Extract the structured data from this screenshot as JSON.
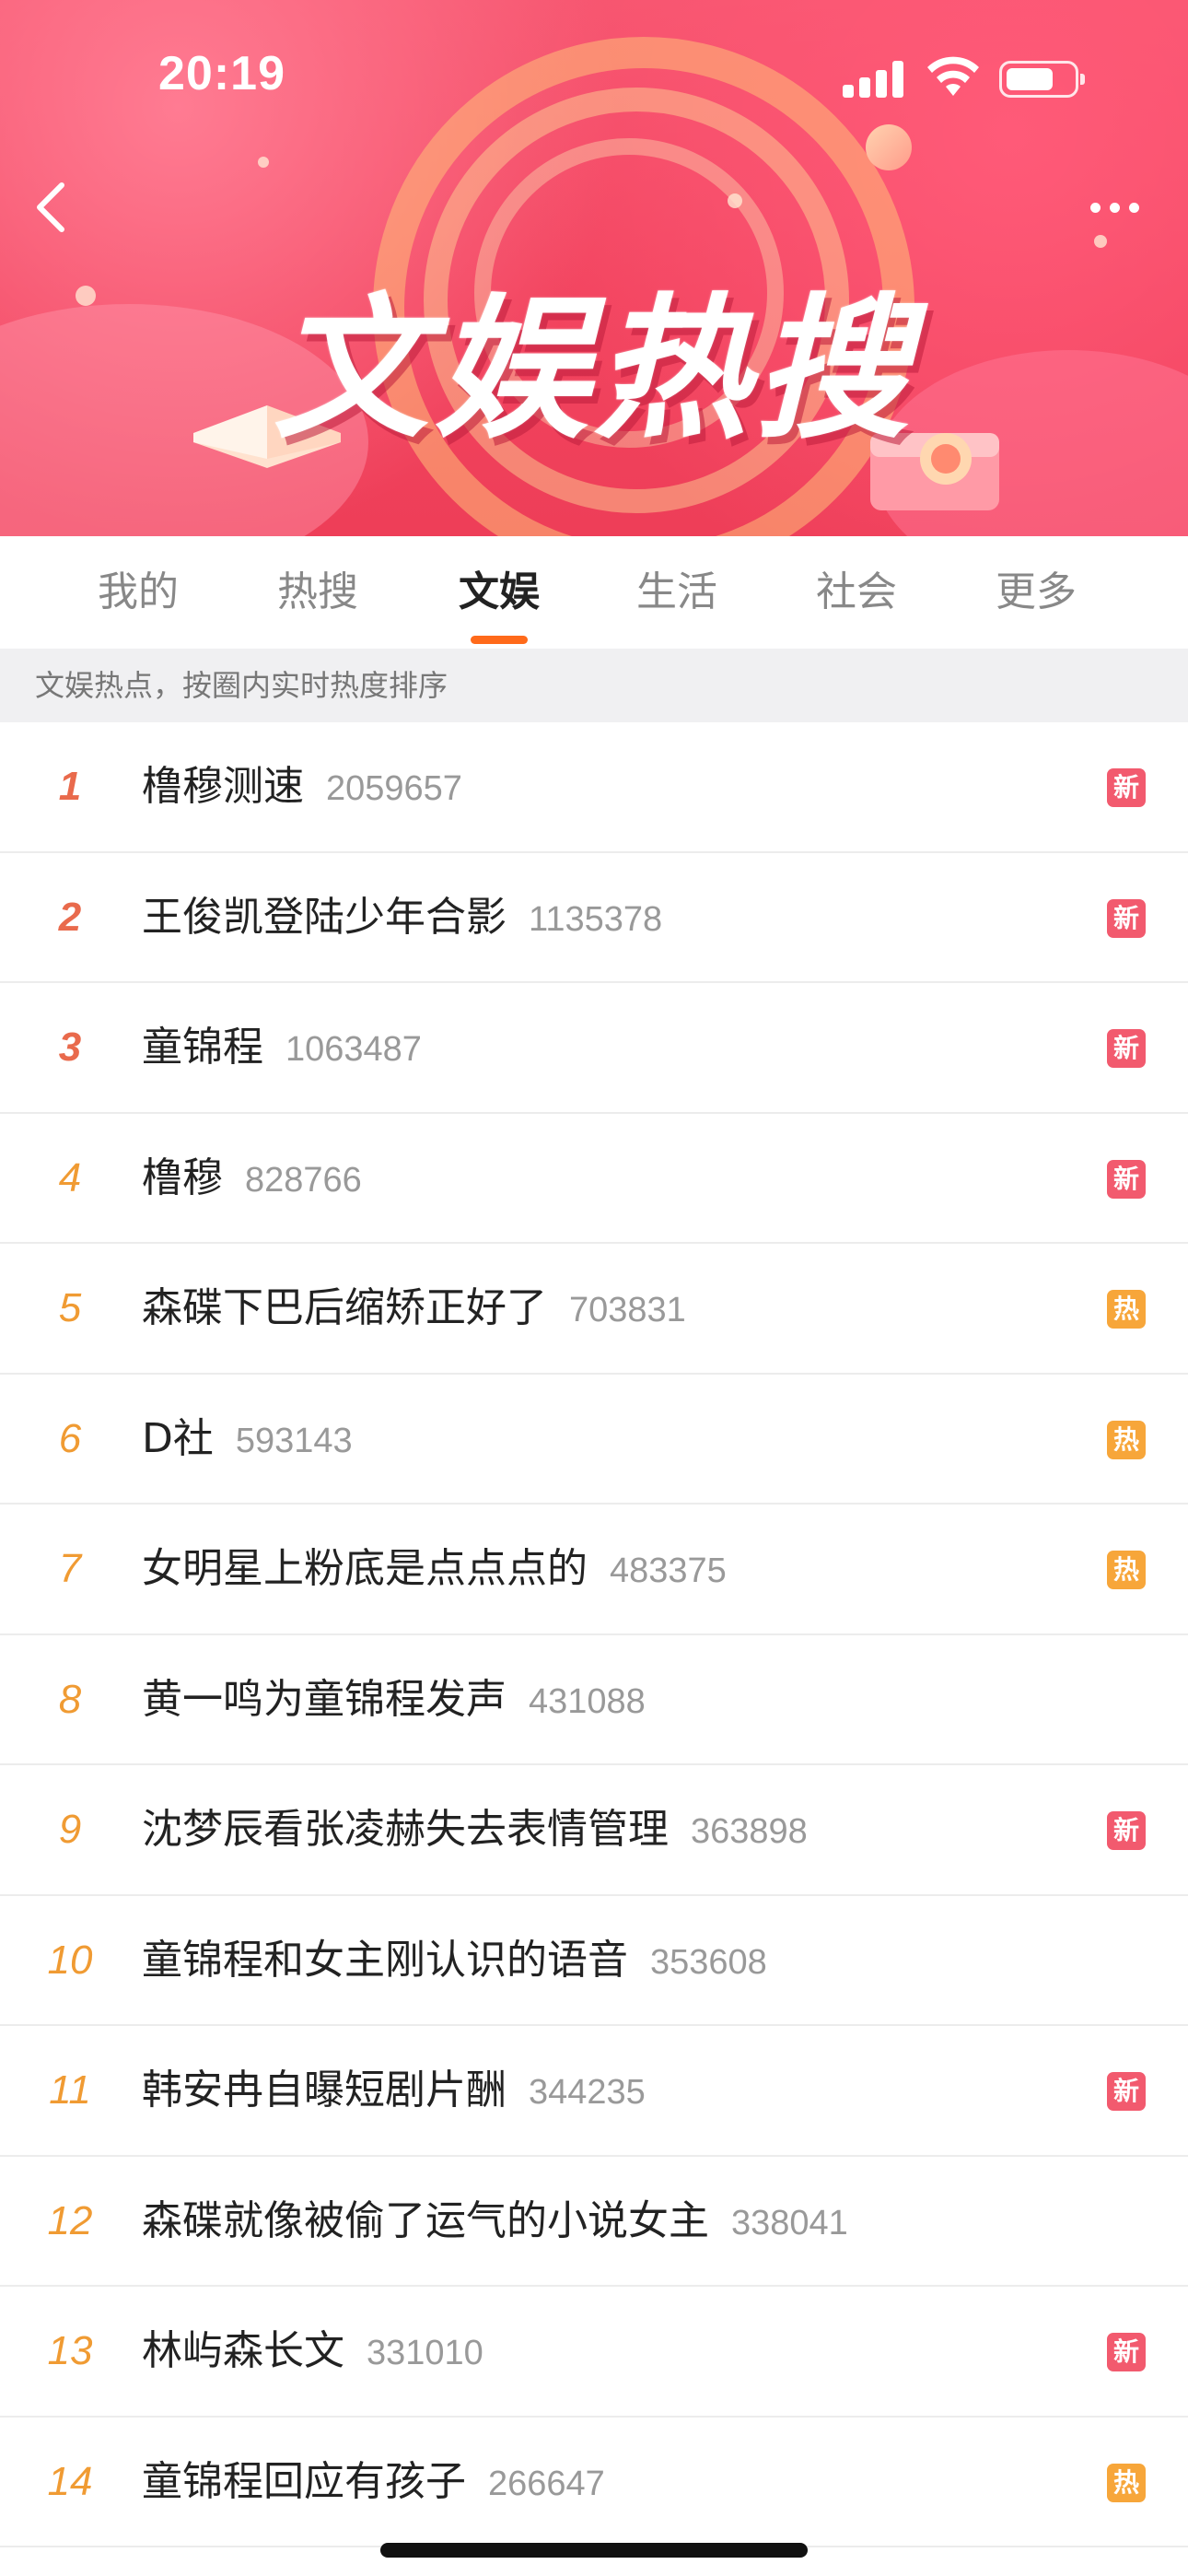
{
  "status_bar": {
    "time": "20:19"
  },
  "banner": {
    "title": "文娱热搜"
  },
  "tabs": [
    {
      "label": "我的"
    },
    {
      "label": "热搜"
    },
    {
      "label": "文娱"
    },
    {
      "label": "生活"
    },
    {
      "label": "社会"
    },
    {
      "label": "更多"
    }
  ],
  "active_tab": "文娱",
  "subtitle": "文娱热点，按圈内实时热度排序",
  "colors": {
    "accent": "#ff6a1a",
    "new_badge": "#f25a6e",
    "hot_badge": "#f7a63a",
    "rank_top": "#e96a4c",
    "rank_normal": "#f09b33"
  },
  "items": [
    {
      "rank": "1",
      "title": "橹穆测速",
      "heat": "2059657",
      "badge": "新"
    },
    {
      "rank": "2",
      "title": "王俊凯登陆少年合影",
      "heat": "1135378",
      "badge": "新"
    },
    {
      "rank": "3",
      "title": "童锦程",
      "heat": "1063487",
      "badge": "新"
    },
    {
      "rank": "4",
      "title": "橹穆",
      "heat": "828766",
      "badge": "新"
    },
    {
      "rank": "5",
      "title": "森碟下巴后缩矫正好了",
      "heat": "703831",
      "badge": "热"
    },
    {
      "rank": "6",
      "title": "D社",
      "heat": "593143",
      "badge": "热"
    },
    {
      "rank": "7",
      "title": "女明星上粉底是点点点的",
      "heat": "483375",
      "badge": "热"
    },
    {
      "rank": "8",
      "title": "黄一鸣为童锦程发声",
      "heat": "431088",
      "badge": ""
    },
    {
      "rank": "9",
      "title": "沈梦辰看张凌赫失去表情管理",
      "heat": "363898",
      "badge": "新"
    },
    {
      "rank": "10",
      "title": "童锦程和女主刚认识的语音",
      "heat": "353608",
      "badge": ""
    },
    {
      "rank": "11",
      "title": "韩安冉自曝短剧片酬",
      "heat": "344235",
      "badge": "新"
    },
    {
      "rank": "12",
      "title": "森碟就像被偷了运气的小说女主",
      "heat": "338041",
      "badge": ""
    },
    {
      "rank": "13",
      "title": "林屿森长文",
      "heat": "331010",
      "badge": "新"
    },
    {
      "rank": "14",
      "title": "童锦程回应有孩子",
      "heat": "266647",
      "badge": "热"
    }
  ]
}
